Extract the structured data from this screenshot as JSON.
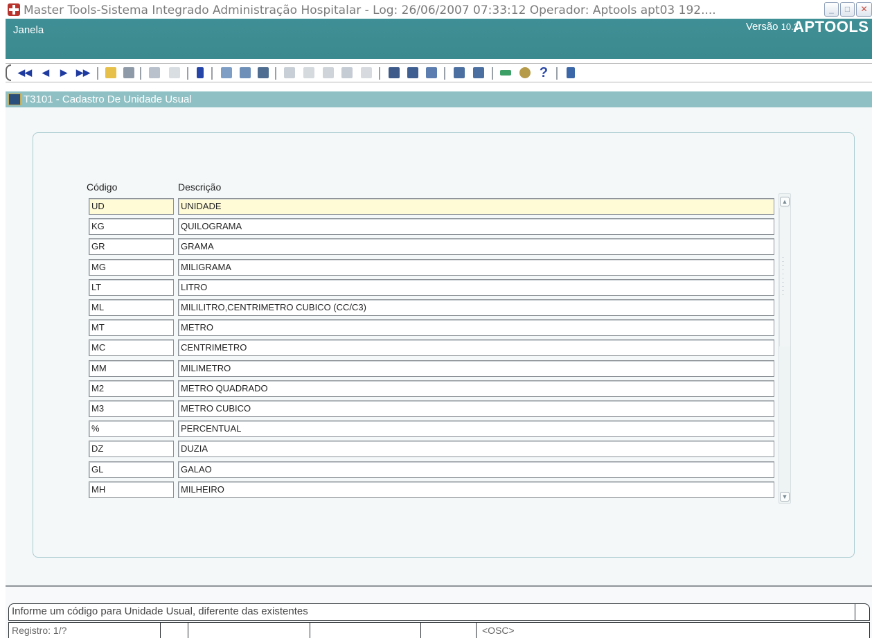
{
  "window": {
    "title": "Master Tools-Sistema Integrado Administração Hospitalar - Log: 26/06/2007 07:33:12 Operador: Aptools apt03 192....",
    "minimize": "_",
    "maximize": "□",
    "close": "✕"
  },
  "menubar": {
    "janela_label": "Janela",
    "versao_label": "Versão",
    "versao_number": "10.2",
    "brand": "APTOOLS"
  },
  "toolbar": {
    "first": "◀◀",
    "prev": "◀",
    "next": "▶",
    "last": "▶▶",
    "help": "?"
  },
  "form": {
    "title": "T3101 - Cadastro De Unidade Usual",
    "col_codigo": "Código",
    "col_descricao": "Descrição",
    "rows": [
      {
        "code": "UD",
        "desc": "UNIDADE"
      },
      {
        "code": "KG",
        "desc": "QUILOGRAMA"
      },
      {
        "code": "GR",
        "desc": "GRAMA"
      },
      {
        "code": "MG",
        "desc": "MILIGRAMA"
      },
      {
        "code": "LT",
        "desc": "LITRO"
      },
      {
        "code": "ML",
        "desc": "MILILITRO,CENTRIMETRO CUBICO (CC/C3)"
      },
      {
        "code": "MT",
        "desc": "METRO"
      },
      {
        "code": "MC",
        "desc": "CENTRIMETRO"
      },
      {
        "code": "MM",
        "desc": "MILIMETRO"
      },
      {
        "code": "M2",
        "desc": "METRO QUADRADO"
      },
      {
        "code": "M3",
        "desc": "METRO CUBICO"
      },
      {
        "code": "%",
        "desc": "PERCENTUAL"
      },
      {
        "code": "DZ",
        "desc": "DUZIA"
      },
      {
        "code": "GL",
        "desc": "GALAO"
      },
      {
        "code": "MH",
        "desc": "MILHEIRO"
      }
    ]
  },
  "status": {
    "hint": "Informe um código para  Unidade Usual, diferente das existentes",
    "registro": "Registro: 1/?",
    "mode": "<OSC>"
  },
  "colors": {
    "menubar": "#3f8f96",
    "form_titlebar": "#8ec0c4",
    "current_row": "#fffbd7",
    "frame_border": "#a9cbd0"
  }
}
